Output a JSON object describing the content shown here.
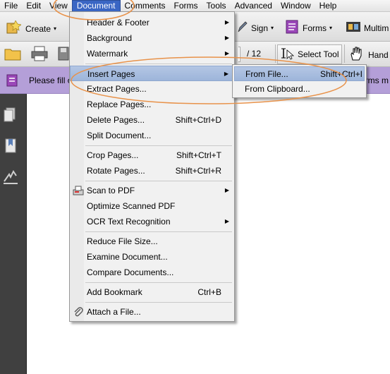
{
  "menubar": {
    "items": [
      {
        "label": "File",
        "active": false
      },
      {
        "label": "Edit",
        "active": false
      },
      {
        "label": "View",
        "active": false
      },
      {
        "label": "Document",
        "active": true
      },
      {
        "label": "Comments",
        "active": false
      },
      {
        "label": "Forms",
        "active": false
      },
      {
        "label": "Tools",
        "active": false
      },
      {
        "label": "Advanced",
        "active": false
      },
      {
        "label": "Window",
        "active": false
      },
      {
        "label": "Help",
        "active": false
      }
    ]
  },
  "toolbar1": {
    "create_label": "Create",
    "sign_label": "Sign",
    "forms_label": "Forms",
    "multimedia_label": "Multim"
  },
  "toolbar2": {
    "page_total": "/ 12",
    "select_tool_label": "Select Tool",
    "hand_label": "Hand"
  },
  "infobar": {
    "text_left": "Please fill o",
    "text_right": "orms m"
  },
  "document_menu": {
    "items": [
      {
        "label": "Header & Footer",
        "shortcut": "",
        "submenu": true
      },
      {
        "label": "Background",
        "shortcut": "",
        "submenu": true
      },
      {
        "label": "Watermark",
        "shortcut": "",
        "submenu": true
      },
      {
        "label": "Insert Pages",
        "shortcut": "",
        "submenu": true,
        "highlighted": true
      },
      {
        "label": "Extract Pages...",
        "shortcut": "",
        "submenu": false
      },
      {
        "label": "Replace Pages...",
        "shortcut": "",
        "submenu": false
      },
      {
        "label": "Delete Pages...",
        "shortcut": "Shift+Ctrl+D",
        "submenu": false
      },
      {
        "label": "Split Document...",
        "shortcut": "",
        "submenu": false
      },
      {
        "label": "Crop Pages...",
        "shortcut": "Shift+Ctrl+T",
        "submenu": false
      },
      {
        "label": "Rotate Pages...",
        "shortcut": "Shift+Ctrl+R",
        "submenu": false
      },
      {
        "label": "Scan to PDF",
        "shortcut": "",
        "submenu": true
      },
      {
        "label": "Optimize Scanned PDF",
        "shortcut": "",
        "submenu": false
      },
      {
        "label": "OCR Text Recognition",
        "shortcut": "",
        "submenu": true
      },
      {
        "label": "Reduce File Size...",
        "shortcut": "",
        "submenu": false
      },
      {
        "label": "Examine Document...",
        "shortcut": "",
        "submenu": false
      },
      {
        "label": "Compare Documents...",
        "shortcut": "",
        "submenu": false
      },
      {
        "label": "Add Bookmark",
        "shortcut": "Ctrl+B",
        "submenu": false
      },
      {
        "label": "Attach a File...",
        "shortcut": "",
        "submenu": false
      }
    ]
  },
  "insert_pages_submenu": {
    "items": [
      {
        "label": "From File...",
        "shortcut": "Shift+Ctrl+I",
        "highlighted": true
      },
      {
        "label": "From Clipboard...",
        "shortcut": "",
        "highlighted": false
      }
    ]
  },
  "colors": {
    "menu_highlight": "#3a66c4",
    "item_highlight": "#a9bee0",
    "infobar": "#b49fd8",
    "annotation": "#e8924a"
  }
}
